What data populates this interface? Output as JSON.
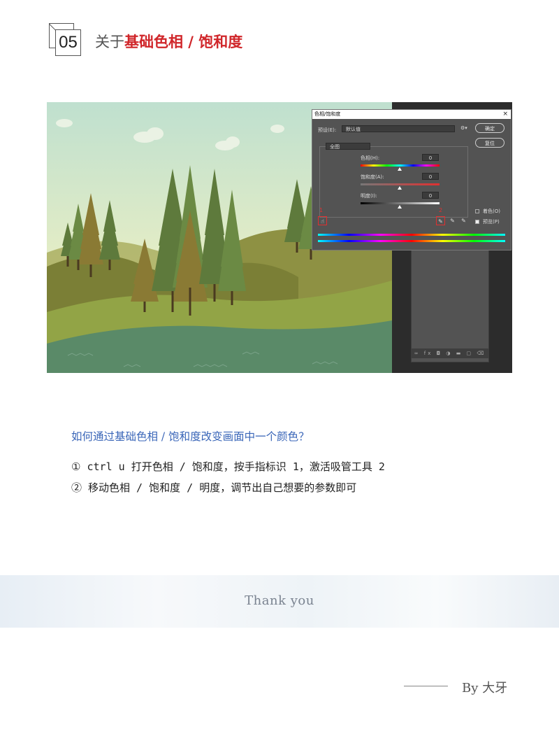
{
  "header": {
    "number": "05",
    "title_prefix": "关于",
    "title_highlight": "基础色相 / 饱和度"
  },
  "screenshot": {
    "dialog": {
      "title": "色相/饱和度",
      "close": "×",
      "preset_label": "预设(E):",
      "preset_value": "默认值",
      "channel_value": "全图",
      "ok_label": "确定",
      "reset_label": "复位",
      "hue_label": "色相(H):",
      "hue_value": "0",
      "saturation_label": "饱和度(A):",
      "saturation_value": "0",
      "lightness_label": "明度(I):",
      "lightness_value": "0",
      "marker_1": "1",
      "marker_2": "2",
      "colorize_label": "着色(O)",
      "preview_label": "预览(P)",
      "colorize_checked": false,
      "preview_checked": true
    },
    "layers_bar_icons": "∞ fx ◘ ◑ ▬ ▢ ⌫"
  },
  "body": {
    "question": "如何通过基础色相 / 饱和度改变画面中一个颜色？",
    "step1": "① ctrl u 打开色相 / 饱和度，按手指标识 1，激活吸管工具 2",
    "step2": "② 移动色相 / 饱和度 / 明度，调节出自己想要的参数即可"
  },
  "footer": {
    "thanks": "Thank  you",
    "signature": "By 大牙"
  }
}
